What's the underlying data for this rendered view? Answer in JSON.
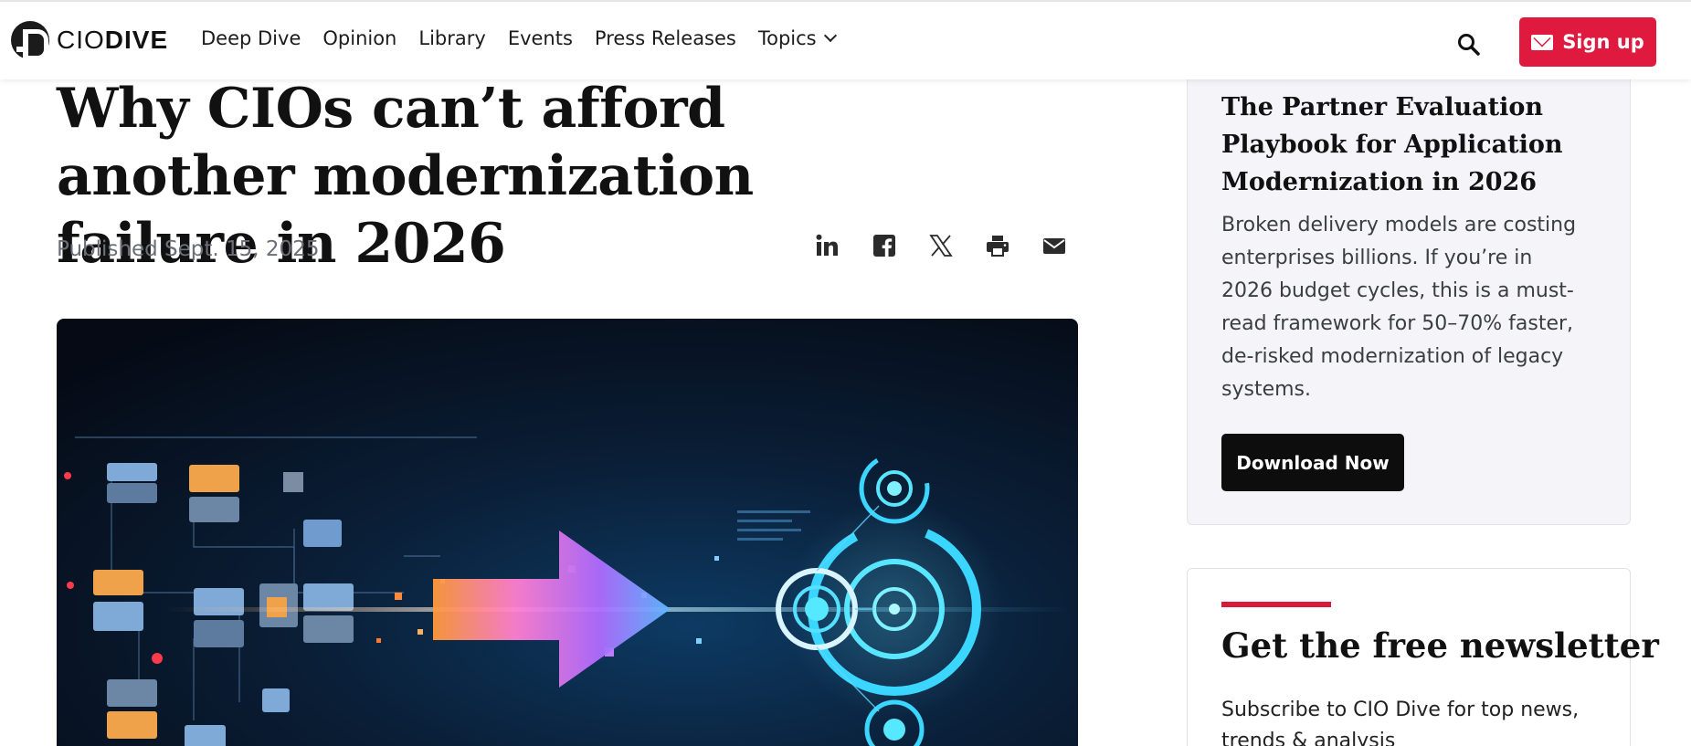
{
  "header": {
    "logo_light": "CIO",
    "logo_bold": "DIVE",
    "nav": [
      {
        "label": "Deep Dive"
      },
      {
        "label": "Opinion"
      },
      {
        "label": "Library"
      },
      {
        "label": "Events"
      },
      {
        "label": "Press Releases"
      },
      {
        "label": "Topics"
      }
    ],
    "signup_label": "Sign up",
    "accent": "#e01a3f"
  },
  "article": {
    "headline": "Why CIOs can’t afford another modernization failure in 2026",
    "published": "Published Sept. 15, 2025",
    "share_icons": [
      "linkedin-icon",
      "facebook-icon",
      "x-icon",
      "print-icon",
      "email-icon"
    ]
  },
  "promo": {
    "title": "The Partner Evaluation Playbook for Application Modernization in 2026",
    "body": "Broken delivery models are costing enterprises billions. If you’re in 2026 budget cycles, this is a must-read framework for 50–70% faster, de-risked modernization of legacy systems.",
    "cta": "Download Now"
  },
  "newsletter": {
    "title": "Get the free newsletter",
    "text": "Subscribe to CIO Dive for top news, trends & analysis"
  }
}
